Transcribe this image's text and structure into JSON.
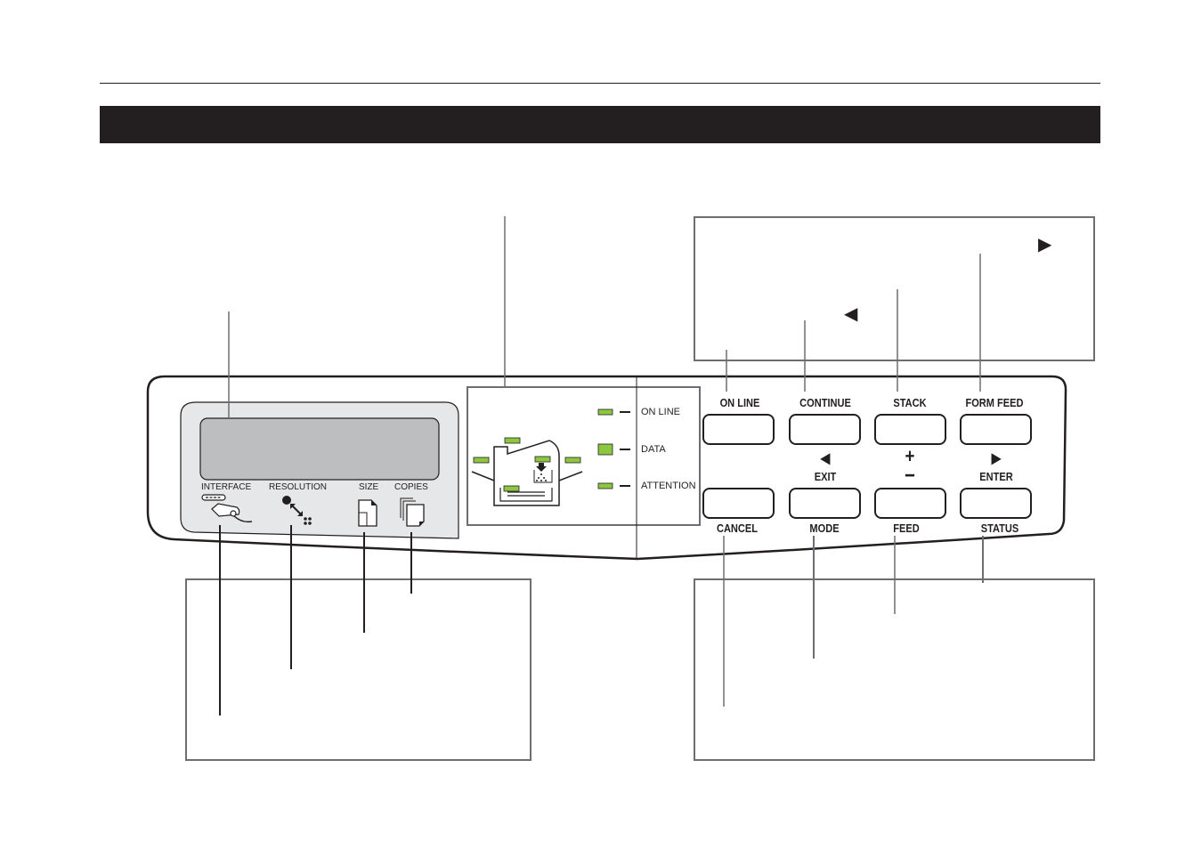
{
  "page": {
    "header_bar_color": "#231f20"
  },
  "display_panel": {
    "labels": {
      "interface": "INTERFACE",
      "resolution": "RESOLUTION",
      "size": "SIZE",
      "copies": "COPIES"
    },
    "icons": [
      "interface-cable-icon",
      "resolution-icon",
      "paper-size-icon",
      "copies-icon"
    ]
  },
  "indicators": {
    "led_color": "#8dc63f",
    "items": [
      {
        "label": "ON LINE"
      },
      {
        "label": "DATA"
      },
      {
        "label": "ATTENTION"
      }
    ],
    "printer_graphic": "printer-status-icon"
  },
  "buttons": {
    "top_row": [
      {
        "label": "ON LINE"
      },
      {
        "label": "CONTINUE"
      },
      {
        "label": "STACK"
      },
      {
        "label": "FORM FEED"
      }
    ],
    "middle_row": [
      {
        "label": "",
        "symbol": ""
      },
      {
        "label": "EXIT",
        "symbol": "◀"
      },
      {
        "label": "−",
        "symbol": "+"
      },
      {
        "label": "ENTER",
        "symbol": "▶"
      }
    ],
    "bottom_row": [
      {
        "label": "CANCEL"
      },
      {
        "label": "MODE"
      },
      {
        "label": "FEED"
      },
      {
        "label": "STATUS"
      }
    ]
  },
  "callouts": {
    "top_right_symbols": {
      "right_arrow": "▶",
      "left_arrow": "◀"
    }
  }
}
